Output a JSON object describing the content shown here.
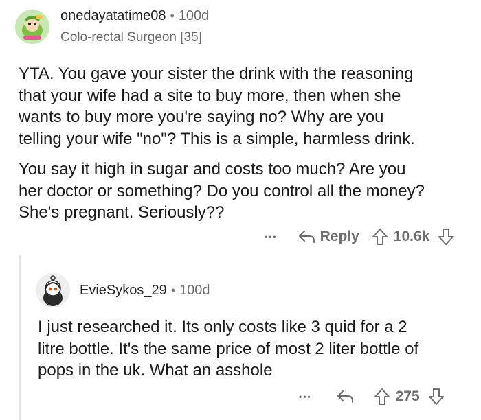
{
  "comment1": {
    "username": "onedayatatime08",
    "separator": "•",
    "age": "100d",
    "flair": "Colo-rectal Surgeon [35]",
    "paragraphs": [
      [
        "YTA. You gave your sister the drink with the reasoning",
        "that your wife had a site to buy more, then when she",
        "wants to buy more you're saying no? Why are you",
        "telling your wife \"no\"? This is a simple, harmless drink."
      ],
      [
        "You say it high in sugar and costs too much? Are you",
        "her doctor or something? Do you control all the money?",
        "She's pregnant. Seriously??"
      ]
    ],
    "more_label": "•••",
    "reply_label": "Reply",
    "score": "10.6k"
  },
  "comment2": {
    "username": "EvieSykos_29",
    "separator": "•",
    "age": "100d",
    "lines": [
      "I just researched it. Its only costs like 3 quid for a 2",
      "litre bottle. It's the same price of most 2 liter bottle of",
      "pops in the uk. What an asshole"
    ],
    "more_label": "•••",
    "score": "275"
  },
  "colors": {
    "text": "#1a1a1b",
    "meta": "#6b6b6b",
    "thread_line": "#e2e2e2",
    "avatar1_bg": "#d9f0c9",
    "avatar2_bg": "#f2f2f2"
  },
  "icons": [
    "avatar-snoo-green",
    "avatar-snoo-dark",
    "reply-arrow-icon",
    "upvote-icon",
    "downvote-icon",
    "more-options-icon"
  ]
}
